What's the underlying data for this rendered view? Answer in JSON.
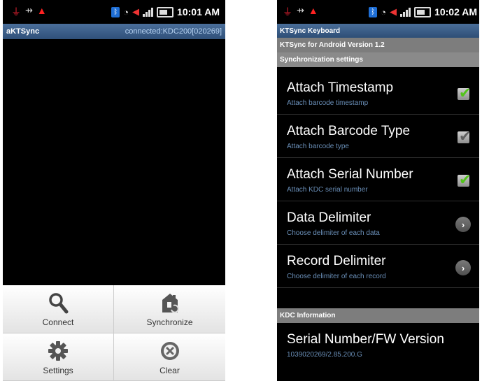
{
  "left": {
    "status_time": "10:01 AM",
    "app_title": "aKTSync",
    "connection_status": "connected:KDC200[020269]",
    "menu": [
      {
        "label": "Connect",
        "icon": "search-icon"
      },
      {
        "label": "Synchronize",
        "icon": "synchronize-icon"
      },
      {
        "label": "Settings",
        "icon": "gear-icon"
      },
      {
        "label": "Clear",
        "icon": "clear-icon"
      }
    ]
  },
  "right": {
    "status_time": "10:02 AM",
    "title": "KTSync Keyboard",
    "version_header": "KTSync for Android Version 1.2",
    "sync_header": "Synchronization settings",
    "prefs": [
      {
        "title": "Attach Timestamp",
        "summary": "Attach barcode timestamp",
        "widget": "checkbox",
        "checked": true
      },
      {
        "title": "Attach Barcode Type",
        "summary": "Attach barcode type",
        "widget": "checkbox",
        "checked": false
      },
      {
        "title": "Attach Serial Number",
        "summary": "Attach KDC serial number",
        "widget": "checkbox",
        "checked": true
      },
      {
        "title": "Data Delimiter",
        "summary": "Choose delimiter of each data",
        "widget": "chevron"
      },
      {
        "title": "Record Delimiter",
        "summary": "Choose delimiter of each record",
        "widget": "chevron"
      }
    ],
    "kdc_header": "KDC Information",
    "serial_title": "Serial Number/FW Version",
    "serial_value": "1039020269/2.85.200.G"
  },
  "colors": {
    "titlebar": "#3d5f8a",
    "section_header": "#7d7d7d",
    "summary_text": "#6a8fb8",
    "check_green": "#52c41a"
  }
}
